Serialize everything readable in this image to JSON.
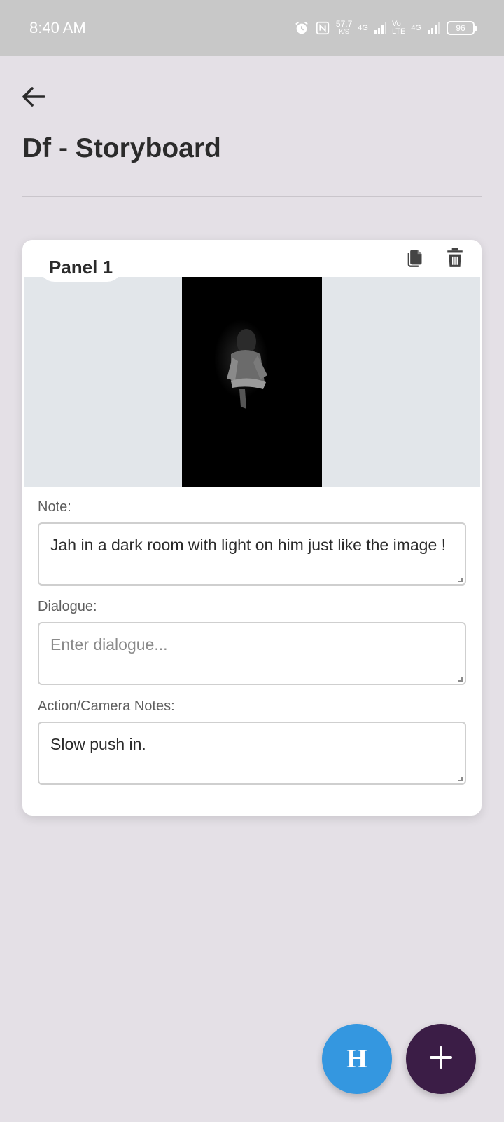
{
  "status_bar": {
    "time": "8:40 AM",
    "net_speed": "57.7",
    "net_speed_unit": "K/S",
    "signal1": "4G",
    "volte_top": "Vo",
    "volte_bottom": "LTE",
    "signal2": "4G",
    "battery": "96"
  },
  "header": {
    "back_icon": "arrow-left-icon",
    "title": "Df - Storyboard"
  },
  "panel": {
    "label": "Panel 1",
    "copy_icon": "copy-icon",
    "delete_icon": "trash-icon",
    "note_label": "Note:",
    "note_value": "Jah in a dark room with light on him just like the image !",
    "dialogue_label": "Dialogue:",
    "dialogue_placeholder": "Enter dialogue...",
    "action_label": "Action/Camera Notes:",
    "action_value": "Slow push in."
  },
  "fabs": {
    "h_label": "H",
    "add_icon": "plus-icon"
  },
  "colors": {
    "background": "#e4e0e6",
    "fab_h": "#3497e0",
    "fab_add": "#3b1d46",
    "status_bar": "#c8c8c8"
  }
}
